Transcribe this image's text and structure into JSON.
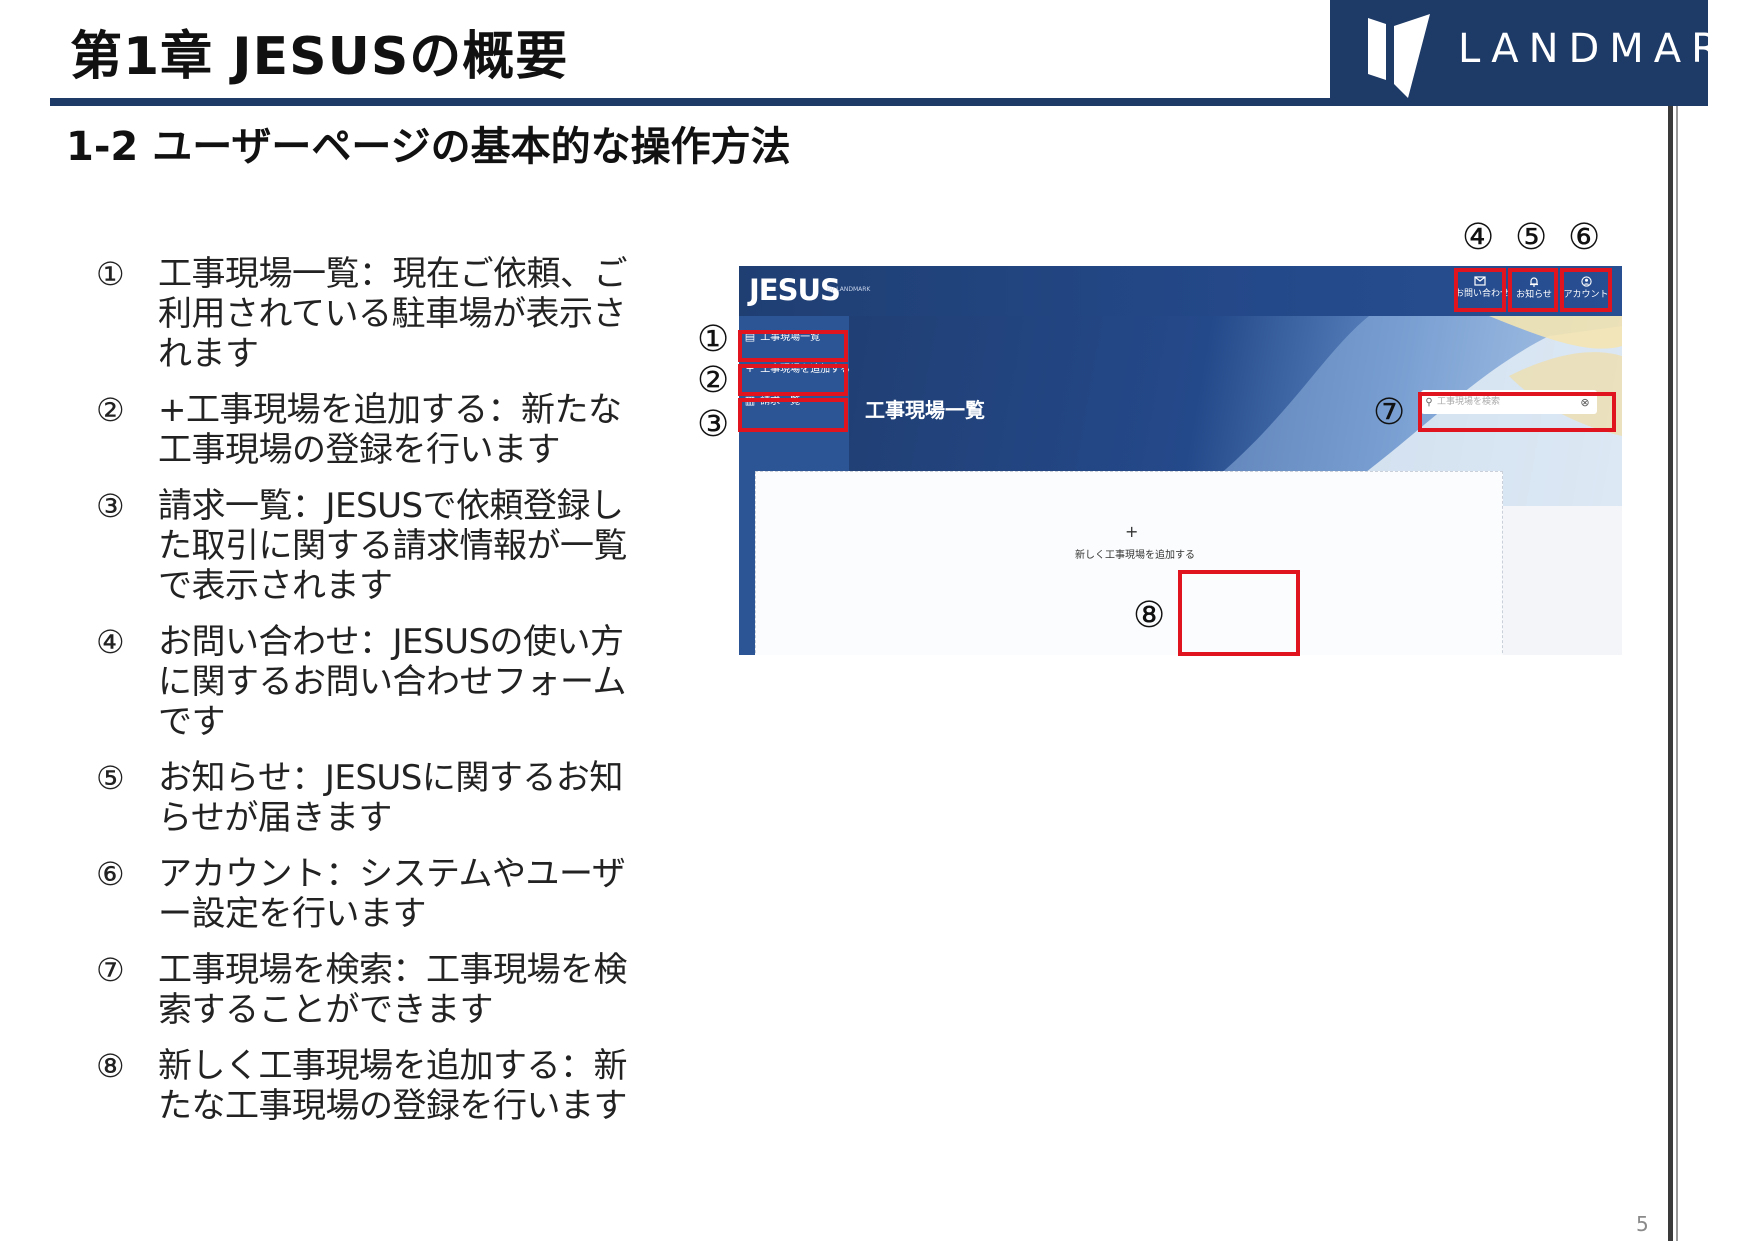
{
  "slide": {
    "chapter_title": "第1章 JESUSの概要",
    "section_title": "1-2 ユーザーページの基本的な操作方法",
    "logo_text": "LANDMARK",
    "page_number": "5"
  },
  "descriptions": [
    {
      "num": "①",
      "text": "工事現場一覧：現在ご依頼、ご利用されている駐車場が表示されます"
    },
    {
      "num": "②",
      "text": "+工事現場を追加する：新たな工事現場の登録を行います"
    },
    {
      "num": "③",
      "text": "請求一覧：JESUSで依頼登録した取引に関する請求情報が一覧で表示されます"
    },
    {
      "num": "④",
      "text": "お問い合わせ：JESUSの使い方に関するお問い合わせフォームです"
    },
    {
      "num": "⑤",
      "text": "お知らせ：JESUSに関するお知らせが届きます"
    },
    {
      "num": "⑥",
      "text": "アカウント：システムやユーザー設定を行います"
    },
    {
      "num": "⑦",
      "text": "工事現場を検索：工事現場を検索することができます"
    },
    {
      "num": "⑧",
      "text": "新しく工事現場を追加する：新たな工事現場の登録を行います"
    }
  ],
  "app": {
    "logo": "JESUS",
    "logo_sub": "by LANDMARK",
    "topbar": {
      "contact_label": "お問い合わせ",
      "notice_label": "お知らせ",
      "account_label": "アカウント"
    },
    "sidebar": {
      "items": [
        {
          "icon": "clipboard-icon",
          "label": "工事現場一覧"
        },
        {
          "icon": "plus-icon",
          "label": "工事現場を追加する"
        },
        {
          "icon": "document-icon",
          "label": "請求一覧"
        }
      ]
    },
    "page_heading": "工事現場一覧",
    "search": {
      "placeholder": "工事現場を検索",
      "value": ""
    },
    "add_card": {
      "plus": "+",
      "label": "新しく工事現場を追加する"
    }
  },
  "markers": {
    "m1": "①",
    "m2": "②",
    "m3": "③",
    "m4": "④",
    "m5": "⑤",
    "m6": "⑥",
    "m7": "⑦",
    "m8": "⑧"
  },
  "colors": {
    "header_navy": "#1e3a66",
    "app_sidebar": "#2c5596",
    "callout_red": "#e0141e"
  }
}
